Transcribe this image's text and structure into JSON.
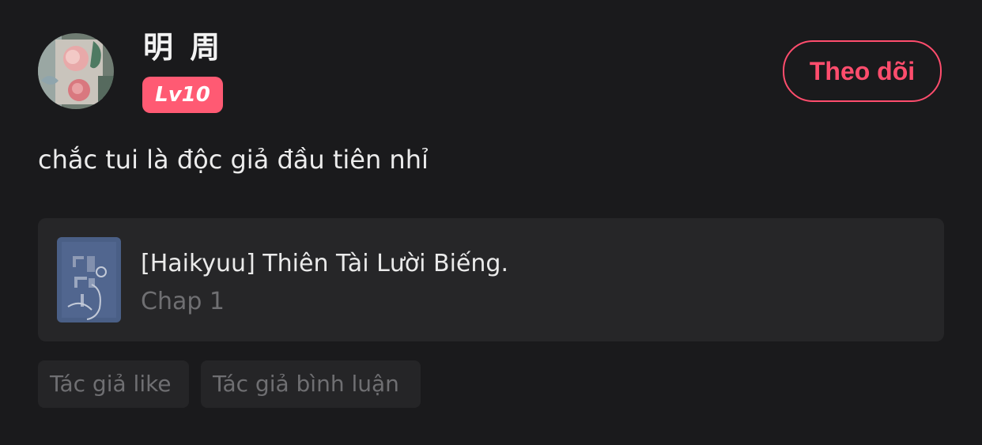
{
  "comment": {
    "user": {
      "name": "明 周",
      "level": "Lv10",
      "avatar": "user-avatar-floral-art"
    },
    "follow_label": "Theo dõi",
    "text": "chắc tui là độc giả đầu tiên nhỉ",
    "story": {
      "title": "[Haikyuu] Thiên Tài Lười Biếng.",
      "chapter": "Chap 1",
      "cover": "story-cover-art"
    },
    "tags": [
      {
        "label": "Tác giả like"
      },
      {
        "label": "Tác giả bình luận"
      }
    ]
  },
  "colors": {
    "background": "#1a1a1c",
    "accent": "#ff4d6d",
    "level_badge": "#ff5a73",
    "card": "#262628",
    "muted_text": "#6f6f72"
  }
}
